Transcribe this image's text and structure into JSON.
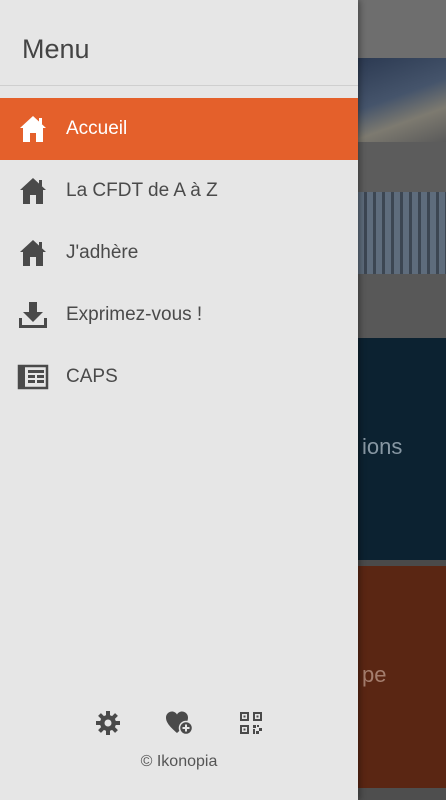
{
  "drawer": {
    "title": "Menu",
    "items": [
      {
        "label": "Accueil",
        "icon": "home-icon",
        "active": true
      },
      {
        "label": "La CFDT de A à Z",
        "icon": "home-icon",
        "active": false
      },
      {
        "label": "J'adhère",
        "icon": "home-icon",
        "active": false
      },
      {
        "label": "Exprimez-vous !",
        "icon": "download-icon",
        "active": false
      },
      {
        "label": "CAPS",
        "icon": "newspaper-icon",
        "active": false
      }
    ],
    "footer": {
      "icons": [
        "gear-icon",
        "heart-plus-icon",
        "qr-code-icon"
      ],
      "copyright": "© Ikonopia"
    }
  },
  "background": {
    "tile1_text": "ions",
    "tile2_text": "pe"
  },
  "colors": {
    "accent": "#e4602b",
    "drawer_bg": "#e6e6e6",
    "icon": "#4a4a4a"
  }
}
